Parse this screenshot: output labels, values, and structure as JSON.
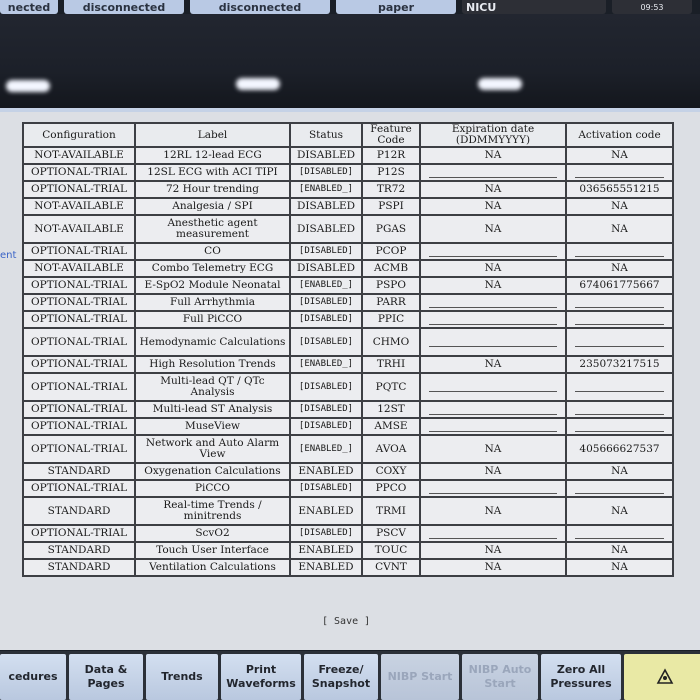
{
  "top_bar": {
    "items": [
      "nected",
      "disconnected",
      "disconnected",
      "paper",
      "NICU",
      "09:53"
    ]
  },
  "side_label": "ent",
  "table": {
    "headers": [
      "Configuration",
      "Label",
      "Status",
      "Feature Code",
      "Expiration date (DDMMYYYY)",
      "Activation code"
    ],
    "rows": [
      {
        "config": "NOT-AVAILABLE",
        "label": "12RL 12-lead ECG",
        "status": "DISABLED",
        "code": "P12R",
        "exp": "NA",
        "act": "NA"
      },
      {
        "config": "OPTIONAL-TRIAL",
        "label": "12SL ECG with ACI TIPI",
        "status": "[DISABLED]",
        "code": "P12S",
        "exp": "",
        "act": ""
      },
      {
        "config": "OPTIONAL-TRIAL",
        "label": "72 Hour trending",
        "status": "[ENABLED_]",
        "code": "TR72",
        "exp": "NA",
        "act": "036565551215"
      },
      {
        "config": "NOT-AVAILABLE",
        "label": "Analgesia / SPI",
        "status": "DISABLED",
        "code": "PSPI",
        "exp": "NA",
        "act": "NA"
      },
      {
        "config": "NOT-AVAILABLE",
        "label": "Anesthetic agent measurement",
        "status": "DISABLED",
        "code": "PGAS",
        "exp": "NA",
        "act": "NA"
      },
      {
        "config": "OPTIONAL-TRIAL",
        "label": "CO",
        "status": "[DISABLED]",
        "code": "PCOP",
        "exp": "",
        "act": ""
      },
      {
        "config": "NOT-AVAILABLE",
        "label": "Combo Telemetry ECG",
        "status": "DISABLED",
        "code": "ACMB",
        "exp": "NA",
        "act": "NA"
      },
      {
        "config": "OPTIONAL-TRIAL",
        "label": "E-SpO2 Module Neonatal",
        "status": "[ENABLED_]",
        "code": "PSPO",
        "exp": "NA",
        "act": "674061775667"
      },
      {
        "config": "OPTIONAL-TRIAL",
        "label": "Full Arrhythmia",
        "status": "[DISABLED]",
        "code": "PARR",
        "exp": "",
        "act": ""
      },
      {
        "config": "OPTIONAL-TRIAL",
        "label": "Full PiCCO",
        "status": "[DISABLED]",
        "code": "PPIC",
        "exp": "",
        "act": ""
      },
      {
        "config": "OPTIONAL-TRIAL",
        "label": "Hemodynamic Calculations",
        "status": "[DISABLED]",
        "code": "CHMO",
        "exp": "",
        "act": ""
      },
      {
        "config": "OPTIONAL-TRIAL",
        "label": "High Resolution Trends",
        "status": "[ENABLED_]",
        "code": "TRHI",
        "exp": "NA",
        "act": "235073217515"
      },
      {
        "config": "OPTIONAL-TRIAL",
        "label": "Multi-lead QT / QTc Analysis",
        "status": "[DISABLED]",
        "code": "PQTC",
        "exp": "",
        "act": ""
      },
      {
        "config": "OPTIONAL-TRIAL",
        "label": "Multi-lead ST Analysis",
        "status": "[DISABLED]",
        "code": "12ST",
        "exp": "",
        "act": ""
      },
      {
        "config": "OPTIONAL-TRIAL",
        "label": "MuseView",
        "status": "[DISABLED]",
        "code": "AMSE",
        "exp": "",
        "act": ""
      },
      {
        "config": "OPTIONAL-TRIAL",
        "label": "Network and Auto Alarm View",
        "status": "[ENABLED_]",
        "code": "AVOA",
        "exp": "NA",
        "act": "405666627537"
      },
      {
        "config": "STANDARD",
        "label": "Oxygenation Calculations",
        "status": "ENABLED",
        "code": "COXY",
        "exp": "NA",
        "act": "NA"
      },
      {
        "config": "OPTIONAL-TRIAL",
        "label": "PiCCO",
        "status": "[DISABLED]",
        "code": "PPCO",
        "exp": "",
        "act": ""
      },
      {
        "config": "STANDARD",
        "label": "Real-time Trends / minitrends",
        "status": "ENABLED",
        "code": "TRMI",
        "exp": "NA",
        "act": "NA"
      },
      {
        "config": "OPTIONAL-TRIAL",
        "label": "ScvO2",
        "status": "[DISABLED]",
        "code": "PSCV",
        "exp": "",
        "act": ""
      },
      {
        "config": "STANDARD",
        "label": "Touch User Interface",
        "status": "ENABLED",
        "code": "TOUC",
        "exp": "NA",
        "act": "NA"
      },
      {
        "config": "STANDARD",
        "label": "Ventilation Calculations",
        "status": "ENABLED",
        "code": "CVNT",
        "exp": "NA",
        "act": "NA"
      }
    ]
  },
  "save_label": "[ Save ]",
  "toolbar": [
    {
      "label": "cedures",
      "disabled": false
    },
    {
      "label": "Data & Pages",
      "disabled": false
    },
    {
      "label": "Trends",
      "disabled": false
    },
    {
      "label": "Print Waveforms",
      "disabled": false
    },
    {
      "label": "Freeze/ Snapshot",
      "disabled": false
    },
    {
      "label": "NIBP Start",
      "disabled": true
    },
    {
      "label": "NIBP Auto Start",
      "disabled": true
    },
    {
      "label": "Zero All Pressures",
      "disabled": false
    },
    {
      "label": "",
      "disabled": false,
      "icon": "alarm-bell-icon"
    }
  ],
  "colors": {
    "accent": "#b9c9e4",
    "alarm": "#e9e9a5",
    "link": "#3b64c7"
  }
}
